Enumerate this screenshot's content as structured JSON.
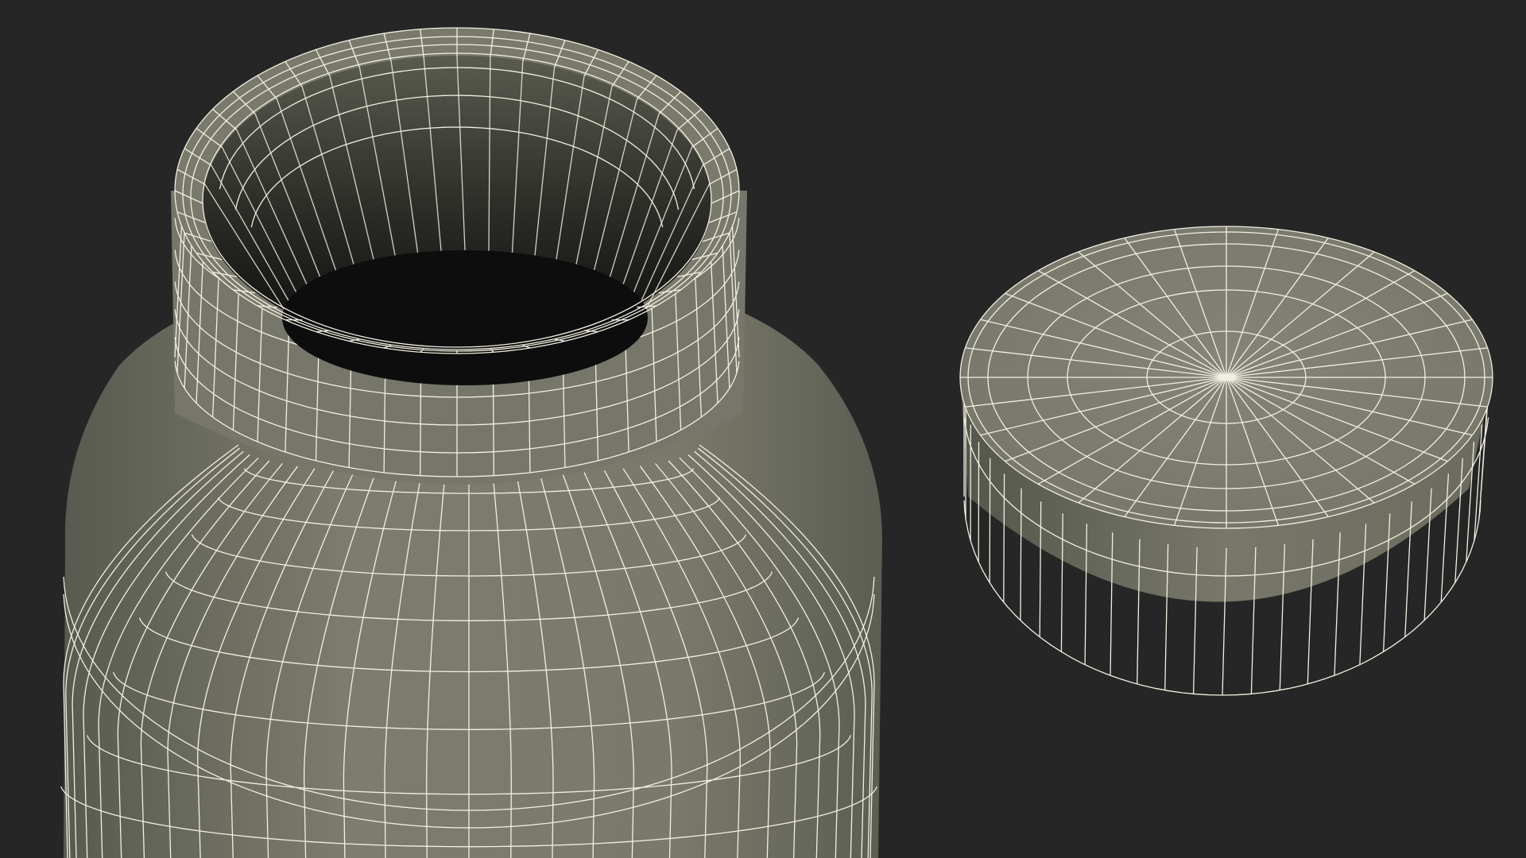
{
  "scene": {
    "background_color": "#262626",
    "wireframe_color": "#f2f0e2",
    "surface_color": "#7b7b6c",
    "surface_shade_color": "#55564c",
    "interior_color": "#0d0d0d",
    "objects": [
      "jar-body",
      "jar-lid"
    ]
  }
}
